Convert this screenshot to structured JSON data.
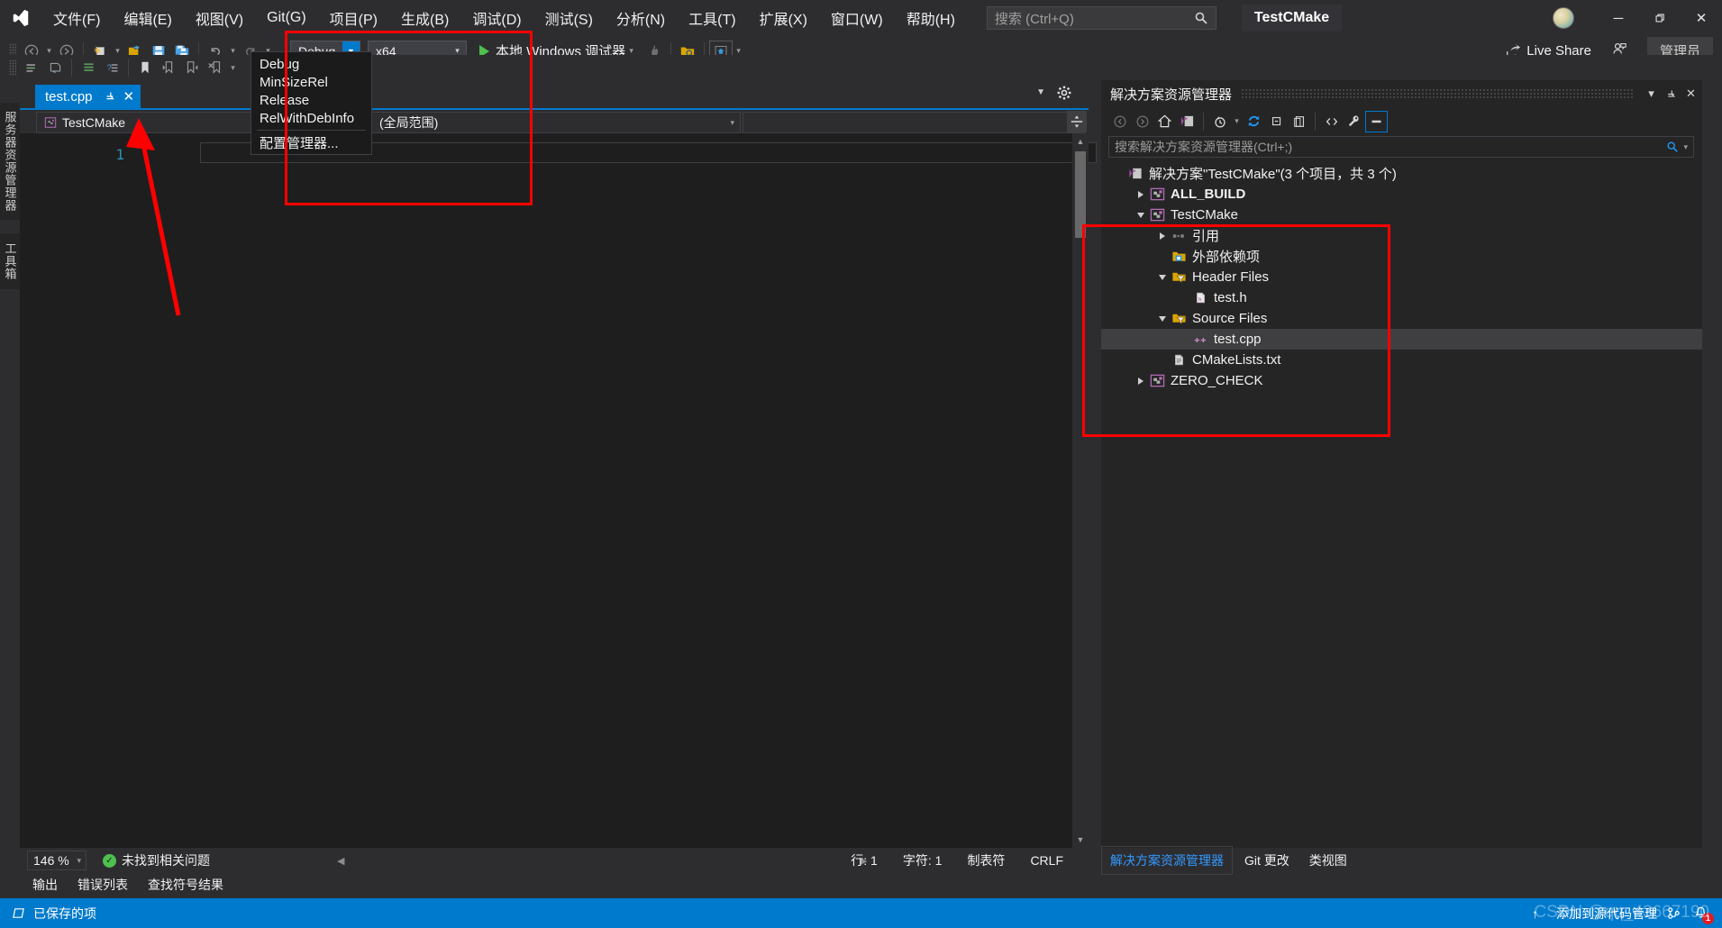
{
  "titlebar": {
    "logo_icon": "visual-studio-logo",
    "menus": [
      {
        "label": "文件(F)"
      },
      {
        "label": "编辑(E)"
      },
      {
        "label": "视图(V)"
      },
      {
        "label": "Git(G)"
      },
      {
        "label": "项目(P)"
      },
      {
        "label": "生成(B)"
      },
      {
        "label": "调试(D)"
      },
      {
        "label": "测试(S)"
      },
      {
        "label": "分析(N)"
      },
      {
        "label": "工具(T)"
      },
      {
        "label": "扩展(X)"
      },
      {
        "label": "窗口(W)"
      },
      {
        "label": "帮助(H)"
      }
    ],
    "search_placeholder": "搜索 (Ctrl+Q)",
    "search_icon": "search-icon",
    "app_title": "TestCMake",
    "avatar_icon": "user-avatar",
    "minimize_icon": "─",
    "restore_icon": "❐",
    "close_icon": "✕"
  },
  "toolbar": {
    "live_share_label": "Live Share",
    "admin_label": "管理员",
    "config": {
      "value": "Debug",
      "options": [
        "Debug",
        "MinSizeRel",
        "Release",
        "RelWithDebInfo"
      ],
      "manager_label": "配置管理器..."
    },
    "platform": {
      "value": "x64"
    },
    "run_label": "本地 Windows 调试器"
  },
  "left_strip": {
    "server_explorer": "服务器资源管理器",
    "toolbox": "工具箱"
  },
  "editor": {
    "tab": {
      "name": "test.cpp",
      "pin_icon": "pin-icon",
      "close_icon": "✕"
    },
    "nav_left": "TestCMake",
    "nav_mid": "(全局范围)",
    "nav_right": "",
    "line_number": "1",
    "status": {
      "zoom": "146 %",
      "issues": "未找到相关问题",
      "line": "行: 1",
      "char": "字符: 1",
      "tabs": "制表符",
      "eol": "CRLF"
    }
  },
  "bottom_tabs": [
    {
      "label": "输出"
    },
    {
      "label": "错误列表"
    },
    {
      "label": "查找符号结果"
    }
  ],
  "solution_explorer": {
    "title": "解决方案资源管理器",
    "search_placeholder": "搜索解决方案资源管理器(Ctrl+;)",
    "search_icon": "search-icon",
    "toolbar_icons": [
      "back-icon",
      "forward-icon",
      "home-icon",
      "solution-icon",
      "pending-changes-icon",
      "refresh-icon",
      "collapse-all-icon",
      "show-all-files-icon",
      "code-view-icon",
      "properties-icon",
      "preview-icon"
    ],
    "tree": [
      {
        "label": "解决方案\"TestCMake\"(3 个项目，共 3 个)",
        "icon": "solution-icon",
        "indent": 0,
        "twisty": "none",
        "bold": false,
        "selected": false
      },
      {
        "label": "ALL_BUILD",
        "icon": "project-icon",
        "indent": 1,
        "twisty": "collapsed",
        "bold": true,
        "selected": false
      },
      {
        "label": "TestCMake",
        "icon": "project-icon",
        "indent": 1,
        "twisty": "expanded",
        "bold": false,
        "selected": false
      },
      {
        "label": "引用",
        "icon": "references-icon",
        "indent": 2,
        "twisty": "collapsed",
        "bold": false,
        "selected": false
      },
      {
        "label": "外部依赖项",
        "icon": "ext-deps-icon",
        "indent": 2,
        "twisty": "none",
        "bold": false,
        "selected": false
      },
      {
        "label": "Header Files",
        "icon": "filter-folder-icon",
        "indent": 2,
        "twisty": "expanded",
        "bold": false,
        "selected": false
      },
      {
        "label": "test.h",
        "icon": "header-file-icon",
        "indent": 3,
        "twisty": "none",
        "bold": false,
        "selected": false
      },
      {
        "label": "Source Files",
        "icon": "filter-folder-icon",
        "indent": 2,
        "twisty": "expanded",
        "bold": false,
        "selected": false
      },
      {
        "label": "test.cpp",
        "icon": "cpp-file-icon",
        "indent": 3,
        "twisty": "none",
        "bold": false,
        "selected": true
      },
      {
        "label": "CMakeLists.txt",
        "icon": "text-file-icon",
        "indent": 2,
        "twisty": "none",
        "bold": false,
        "selected": false
      },
      {
        "label": "ZERO_CHECK",
        "icon": "project-icon",
        "indent": 1,
        "twisty": "collapsed",
        "bold": false,
        "selected": false
      }
    ],
    "bottom_tabs": [
      {
        "label": "解决方案资源管理器",
        "active": true
      },
      {
        "label": "Git 更改",
        "active": false
      },
      {
        "label": "类视图",
        "active": false
      }
    ]
  },
  "status_bar": {
    "saved_label": "已保存的项",
    "saved_icon": "saved-item-icon",
    "add_to_source_control": "添加到源代码管理",
    "up_arrow_icon": "↑",
    "source_control_icon": "source-control-icon",
    "bell_icon": "notification-bell",
    "bell_count": "1"
  },
  "watermark": "CSDN @qq_43667190",
  "colors": {
    "accent": "#007acc",
    "annotation": "#ff0000",
    "chrome": "#2d2d30",
    "editor_bg": "#1e1e1e",
    "panel_bg": "#252526"
  }
}
